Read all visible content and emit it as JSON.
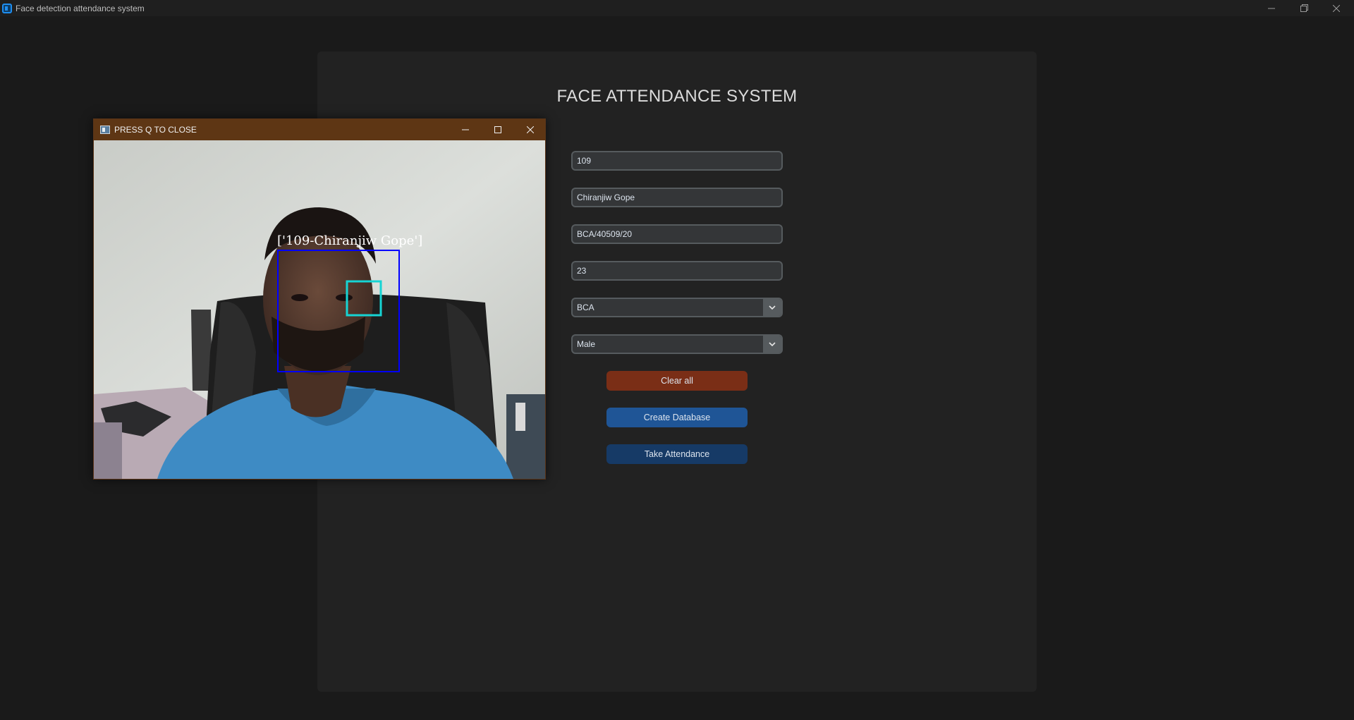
{
  "app": {
    "title": "Face detection attendance system",
    "icon": "app-icon"
  },
  "form": {
    "heading": "FACE ATTENDANCE SYSTEM",
    "fields": {
      "id": "109",
      "name": "Chiranjiw Gope",
      "roll": "BCA/40509/20",
      "age": "23"
    },
    "course_select": {
      "value": "BCA"
    },
    "gender_select": {
      "value": "Male"
    },
    "buttons": {
      "clear": "Clear all",
      "create_db": "Create Database",
      "take_attendance": "Take Attendance"
    }
  },
  "camera_window": {
    "title": "PRESS Q TO CLOSE",
    "recognized_label": "['109-Chiranjiw Gope']"
  },
  "colors": {
    "clear_button": "#7a2e16",
    "create_button": "#1f5596",
    "attendance_button": "#163a66",
    "face_box": "#0000ff",
    "eye_box": "#16d4d4",
    "cam_titlebar": "#5e3614"
  }
}
